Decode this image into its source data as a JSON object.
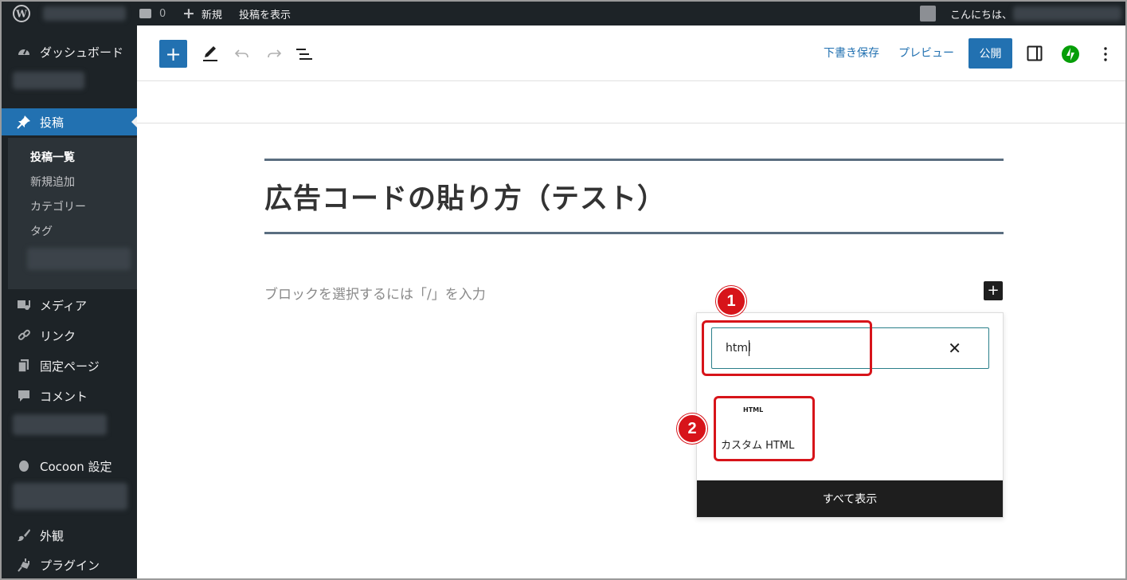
{
  "adminbar": {
    "comments_count": "0",
    "new_label": "新規",
    "view_post_label": "投稿を表示",
    "greeting": "こんにちは、"
  },
  "sidebar": {
    "dashboard": "ダッシュボード",
    "posts": "投稿",
    "submenu": [
      "投稿一覧",
      "新規追加",
      "カテゴリー",
      "タグ"
    ],
    "media": "メディア",
    "links": "リンク",
    "pages": "固定ページ",
    "comments": "コメント",
    "cocoon": "Cocoon 設定",
    "appearance": "外観",
    "plugins": "プラグイン"
  },
  "toolbar": {
    "add_block_icon": "plus-icon",
    "save_draft": "下書き保存",
    "preview": "プレビュー",
    "publish": "公開",
    "accent": "#2271b1",
    "jetpack_color": "#069e08"
  },
  "editor": {
    "post_title": "広告コードの貼り方（テスト）",
    "placeholder": "ブロックを選択するには「/」を入力"
  },
  "inserter": {
    "search_value": "html",
    "block_icon_text": "HTML",
    "block_label": "カスタム HTML",
    "show_all": "すべて表示"
  },
  "annotations": {
    "badge1": "1",
    "badge2": "2",
    "color": "#d7141a"
  }
}
